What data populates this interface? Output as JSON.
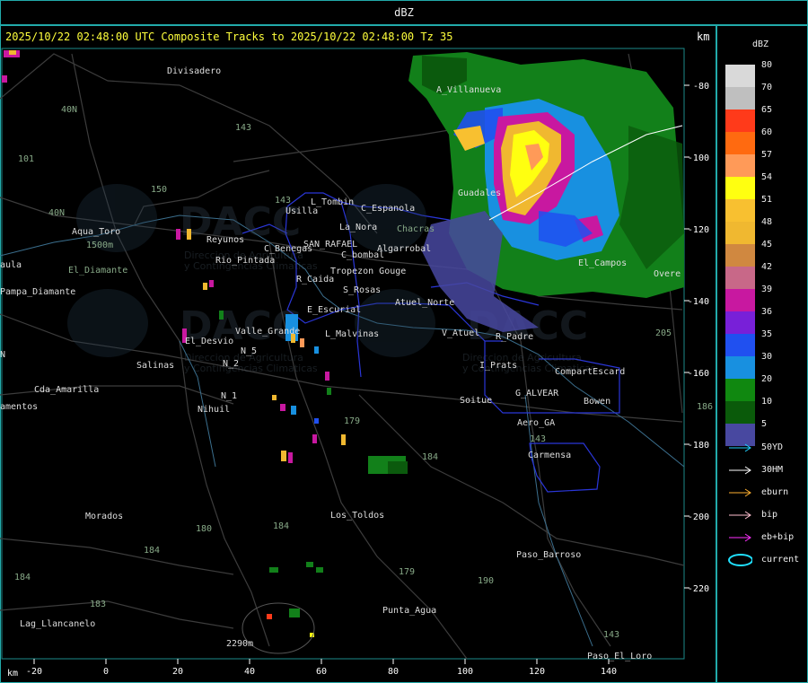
{
  "title": "dBZ",
  "header": {
    "text": "2025/10/22 02:48:00 UTC Composite Tracks to 2025/10/22 02:48:00 Tz 35",
    "km_label": "km"
  },
  "legend": {
    "title": "dBZ",
    "levels": [
      {
        "label": "80",
        "color": "#d9d9d9"
      },
      {
        "label": "70",
        "color": "#bfbfbf"
      },
      {
        "label": "65",
        "color": "#ff3a1a"
      },
      {
        "label": "60",
        "color": "#ff6a10"
      },
      {
        "label": "57",
        "color": "#ff9a58"
      },
      {
        "label": "54",
        "color": "#ffff10"
      },
      {
        "label": "51",
        "color": "#f8c030"
      },
      {
        "label": "48",
        "color": "#f0b830"
      },
      {
        "label": "45",
        "color": "#d08840"
      },
      {
        "label": "42",
        "color": "#c86888"
      },
      {
        "label": "39",
        "color": "#c818a0"
      },
      {
        "label": "36",
        "color": "#7820d8"
      },
      {
        "label": "35",
        "color": "#2050f0"
      },
      {
        "label": "30",
        "color": "#1890e0"
      },
      {
        "label": "20",
        "color": "#108810"
      },
      {
        "label": "10",
        "color": "#0a5a0a"
      },
      {
        "label": "5",
        "color": "#4848a0"
      }
    ],
    "tracks": [
      {
        "label": "50YD",
        "color": "#20d0ff"
      },
      {
        "label": "30HM",
        "color": "#ffffff"
      },
      {
        "label": "eburn",
        "color": "#ffb030"
      },
      {
        "label": "bip",
        "color": "#ffc0d0"
      },
      {
        "label": "eb+bip",
        "color": "#ff30ff"
      },
      {
        "label": "current",
        "color": "#20e0ff"
      }
    ]
  },
  "axes": {
    "x_label": "km",
    "x_ticks": [
      "-20",
      "0",
      "20",
      "40",
      "60",
      "80",
      "100",
      "120",
      "140"
    ],
    "y_ticks": [
      "-80",
      "-100",
      "-120",
      "-140",
      "-160",
      "-180",
      "-200",
      "-220"
    ]
  },
  "places": [
    "Divisadero",
    "A_Villanueva",
    "40N",
    "101",
    "143",
    "150",
    "Guadales",
    "L_Tombin",
    "Usilla",
    "C_Espanola",
    "La_Nora",
    "C_Benegas",
    "SAN_RAFAEL",
    "Algarrobal",
    "C_bombal",
    "Tropezon Gouge",
    "R_Caida",
    "S_Rosas",
    "Atuel_Norte",
    "V_Atuel",
    "R_Padre",
    "E_Escurial",
    "L_Malvinas",
    "Valle_Grande",
    "El_Desvio",
    "Salinas",
    "N_2",
    "N_5",
    "N_1",
    "Nihuil",
    "Cda_Amarilla",
    "amentos",
    "Aqua_Toro",
    "Reyunos",
    "Rio_Pintada",
    "Pampa_Diamante",
    "aula",
    "Soitue",
    "G_ALVEAR",
    "Bowen",
    "CompartEscard",
    "Aero_GA",
    "Carmensa",
    "I_Prats",
    "Morados",
    "Los_Toldos",
    "Paso_Barroso",
    "Punta_Agua",
    "Paso_El_Loro",
    "Lag_Llancanelo",
    "184",
    "179",
    "180",
    "183",
    "190",
    "143",
    "205",
    "186",
    "Overe",
    "El_Campos",
    "2290m",
    "1500m",
    "El_Diamante",
    "N",
    "Chacras"
  ],
  "watermark": {
    "logo": "DACC",
    "line1": "Direccion de Agricultura",
    "line2": "y Contingencias Climaticas"
  }
}
